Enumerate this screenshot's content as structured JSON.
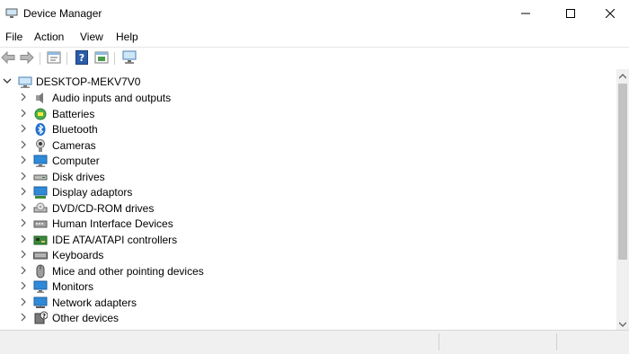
{
  "window": {
    "title": "Device Manager"
  },
  "menu": {
    "items": [
      "File",
      "Action",
      "View",
      "Help"
    ]
  },
  "toolbar": {
    "buttons": [
      "back-icon",
      "forward-icon",
      "properties-icon",
      "help-icon",
      "update-driver-icon",
      "scan-hardware-icon"
    ]
  },
  "tree": {
    "root": "DESKTOP-MEKV7V0",
    "items": [
      {
        "label": "Audio inputs and outputs",
        "icon": "speaker-icon"
      },
      {
        "label": "Batteries",
        "icon": "battery-icon"
      },
      {
        "label": "Bluetooth",
        "icon": "bluetooth-icon"
      },
      {
        "label": "Cameras",
        "icon": "camera-icon"
      },
      {
        "label": "Computer",
        "icon": "computer-icon"
      },
      {
        "label": "Disk drives",
        "icon": "disk-drive-icon"
      },
      {
        "label": "Display adaptors",
        "icon": "display-adapter-icon"
      },
      {
        "label": "DVD/CD-ROM drives",
        "icon": "dvd-drive-icon"
      },
      {
        "label": "Human Interface Devices",
        "icon": "hid-icon"
      },
      {
        "label": "IDE ATA/ATAPI controllers",
        "icon": "ide-controller-icon"
      },
      {
        "label": "Keyboards",
        "icon": "keyboard-icon"
      },
      {
        "label": "Mice and other pointing devices",
        "icon": "mouse-icon"
      },
      {
        "label": "Monitors",
        "icon": "monitor-icon"
      },
      {
        "label": "Network adapters",
        "icon": "network-adapter-icon"
      },
      {
        "label": "Other devices",
        "icon": "other-devices-icon"
      }
    ]
  }
}
